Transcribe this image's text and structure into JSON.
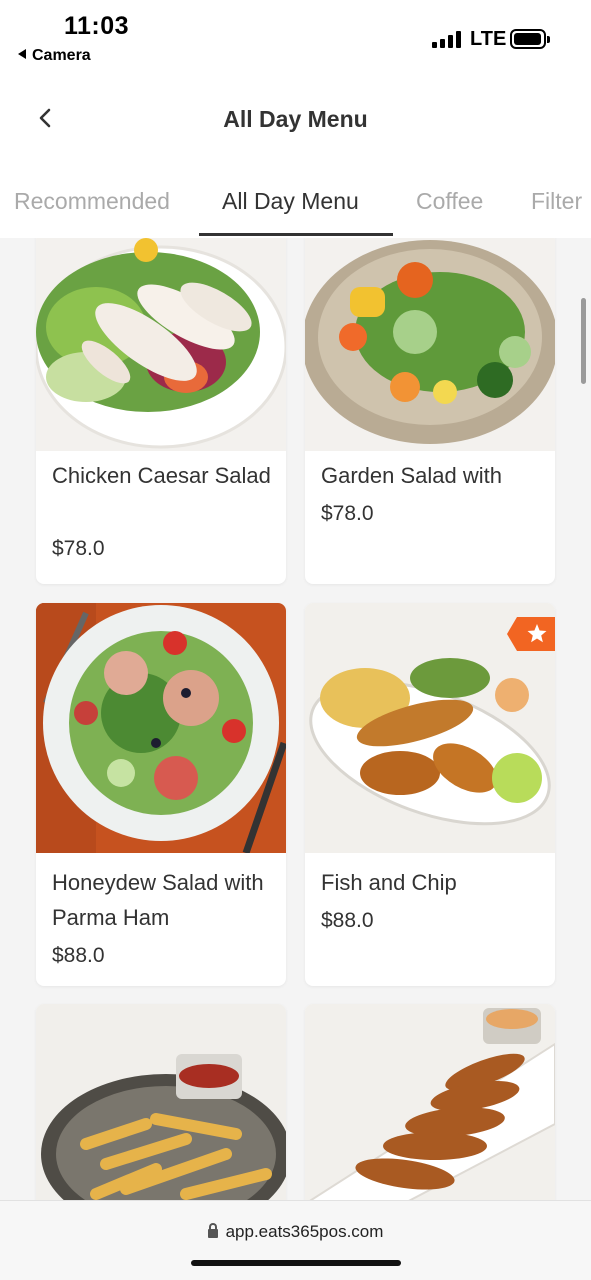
{
  "status_bar": {
    "time": "11:03",
    "back_app": "Camera",
    "network": "LTE"
  },
  "header": {
    "title": "All Day Menu",
    "back_icon": "chevron-left-icon"
  },
  "tabs": [
    {
      "label": "Recommended",
      "active": false
    },
    {
      "label": "All Day Menu",
      "active": true
    },
    {
      "label": "Coffee",
      "active": false
    },
    {
      "label": "Filter",
      "active": false
    }
  ],
  "menu_items": [
    {
      "name": "Chicken Caesar Salad",
      "price": "$78.0",
      "photo": "chicken-caesar-salad-photo",
      "featured": false
    },
    {
      "name": "Garden Salad with",
      "price": "$78.0",
      "photo": "garden-salad-photo",
      "featured": false
    },
    {
      "name": "Honeydew Salad with Parma Ham",
      "price": "$88.0",
      "photo": "honeydew-salad-photo",
      "featured": false
    },
    {
      "name": "Fish and Chip",
      "price": "$88.0",
      "photo": "fish-and-chip-photo",
      "featured": true,
      "badge_icon": "star-icon"
    },
    {
      "name": "",
      "price": "",
      "photo": "french-fries-photo",
      "featured": false
    },
    {
      "name": "",
      "price": "",
      "photo": "chicken-wings-photo",
      "featured": false
    }
  ],
  "colors": {
    "badge": "#f26522",
    "tab_active": "#333333",
    "tab_inactive": "#aaaaaa",
    "background": "#f4f4f4"
  },
  "address_bar": {
    "url": "app.eats365pos.com"
  }
}
